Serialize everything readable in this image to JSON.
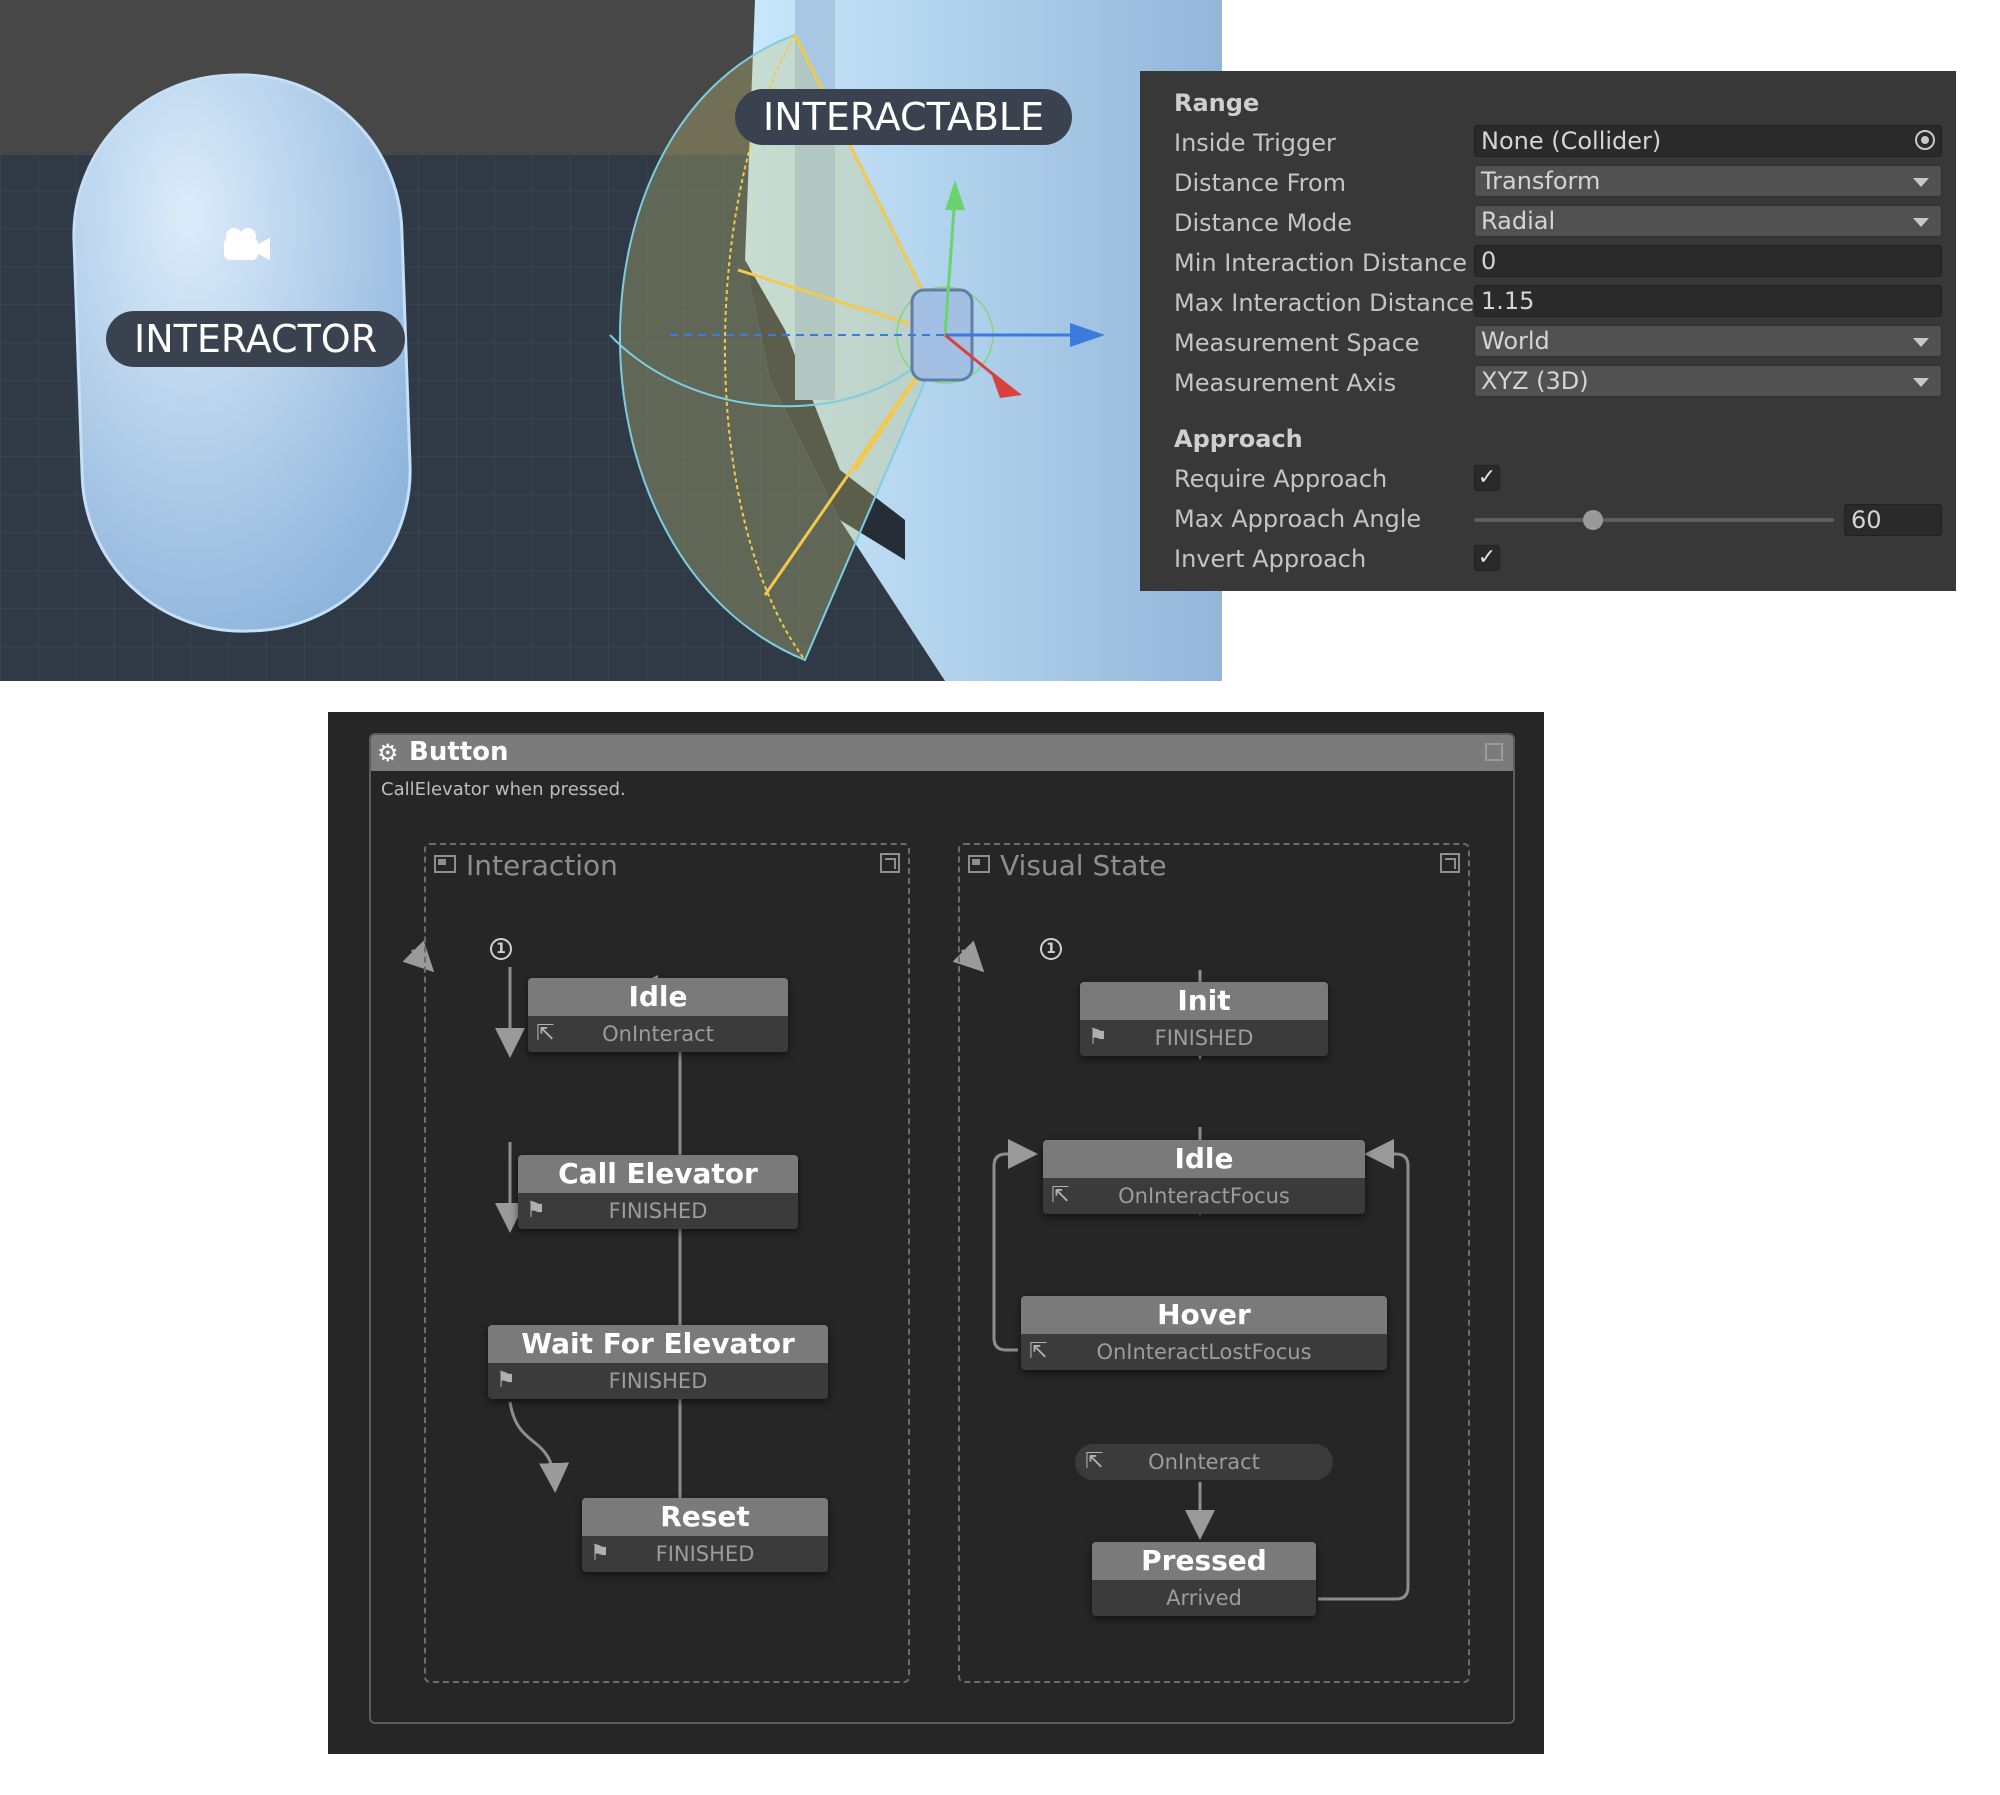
{
  "scene": {
    "interactor_label": "INTERACTOR",
    "interactable_label": "INTERACTABLE",
    "colors": {
      "sky": "#4a4a4a",
      "ground": "#2f3a46",
      "capsule": "#a9cbec",
      "wall": "#b9dcf5",
      "gizmo_yellow": "#f2c94c"
    }
  },
  "inspector": {
    "range_header": "Range",
    "inside_trigger": {
      "label": "Inside Trigger",
      "value": "None (Collider)"
    },
    "distance_from": {
      "label": "Distance From",
      "value": "Transform"
    },
    "distance_mode": {
      "label": "Distance Mode",
      "value": "Radial"
    },
    "min_distance": {
      "label": "Min Interaction Distance",
      "value": "0"
    },
    "max_distance": {
      "label": "Max Interaction Distance",
      "value": "1.15"
    },
    "measurement_space": {
      "label": "Measurement Space",
      "value": "World"
    },
    "measurement_axis": {
      "label": "Measurement Axis",
      "value": "XYZ (3D)"
    },
    "approach_header": "Approach",
    "require_approach": {
      "label": "Require Approach",
      "checked": true
    },
    "max_approach_angle": {
      "label": "Max Approach Angle",
      "value": "60",
      "slider_fraction": 0.33
    },
    "invert_approach": {
      "label": "Invert Approach",
      "checked": true
    }
  },
  "fsm": {
    "title": "Button",
    "description": "CallElevator when pressed.",
    "interaction": {
      "title": "Interaction",
      "states": [
        {
          "name": "Idle",
          "event": "OnInteract",
          "icon": "cursor-icon"
        },
        {
          "name": "Call Elevator",
          "event": "FINISHED",
          "icon": "flag-icon"
        },
        {
          "name": "Wait For Elevator",
          "event": "FINISHED",
          "icon": "flag-icon"
        },
        {
          "name": "Reset",
          "event": "FINISHED",
          "icon": "flag-icon"
        }
      ]
    },
    "visual_state": {
      "title": "Visual State",
      "states": [
        {
          "name": "Init",
          "event": "FINISHED",
          "icon": "flag-icon"
        },
        {
          "name": "Idle",
          "event": "OnInteractFocus",
          "icon": "cursor-icon"
        },
        {
          "name": "Hover",
          "event": "OnInteractLostFocus",
          "icon": "cursor-icon"
        },
        {
          "name": "Pressed",
          "event": "Arrived",
          "icon": "none"
        }
      ],
      "global_event": "OnInteract"
    }
  }
}
